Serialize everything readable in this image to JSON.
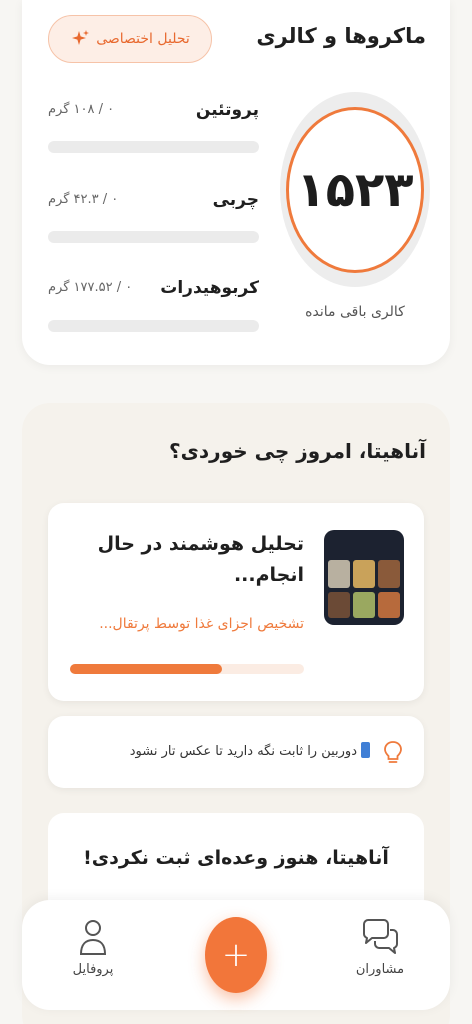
{
  "macros_card": {
    "title": "ماکروها و کالری",
    "ai_button_label": "تحلیل اختصاصی",
    "ai_icon": "sparkle-icon",
    "calories_remaining": "۱۵۲۳",
    "calories_caption": "کالری باقی مانده",
    "items": [
      {
        "name": "پروتئین",
        "value": "۰ / ۱۰۸ گرم",
        "progress": 0
      },
      {
        "name": "چربی",
        "value": "۰ / ۴۲.۳ گرم",
        "progress": 0
      },
      {
        "name": "کربوهیدرات",
        "value": "۰ / ۱۷۷.۵۲ گرم",
        "progress": 0
      }
    ]
  },
  "today_card": {
    "title": "آناهیتا، امروز چی خوردی؟",
    "analysis": {
      "title": "تحلیل هوشمند در حال انجام...",
      "status": "تشخیص اجزای غذا توسط پرتقال...",
      "progress": 0.65
    },
    "tip": {
      "icon": "lightbulb-icon",
      "text": "دوربین را ثابت نگه دارید تا عکس تار نشود"
    },
    "empty_state": {
      "title": "آناهیتا، هنوز وعده‌ای ثبت نکردی!"
    }
  },
  "bottom_nav": {
    "left_label": "پروفایل",
    "left_icon": "person-icon",
    "right_label": "مشاوران",
    "right_icon": "chat-bubbles-icon",
    "fab_icon": "plus-icon",
    "fab_glyph": "+"
  },
  "colors": {
    "accent": "#ef7a3c",
    "bar_bg": "#ebebeb",
    "card_bg": "#ffffff",
    "page_bg": "#f7f6f3"
  }
}
